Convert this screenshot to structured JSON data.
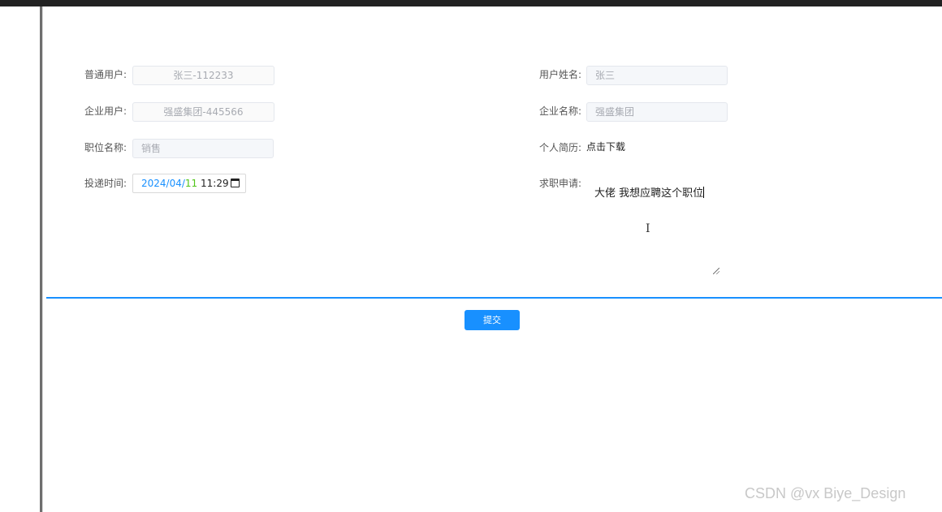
{
  "form": {
    "ordinary_user": {
      "label": "普通用户:",
      "value": "张三-112233"
    },
    "user_name": {
      "label": "用户姓名:",
      "value": "张三"
    },
    "enterprise_user": {
      "label": "企业用户:",
      "value": "强盛集团-445566"
    },
    "enterprise_name": {
      "label": "企业名称:",
      "value": "强盛集团"
    },
    "position_name": {
      "label": "职位名称:",
      "value": "销售"
    },
    "resume": {
      "label": "个人简历:",
      "link_text": "点击下载"
    },
    "delivery_time": {
      "label": "投递时间:",
      "year": "2024",
      "month": "04",
      "day": "11",
      "time": "11:29",
      "sep": "/"
    },
    "application": {
      "label": "求职申请:",
      "text": "大佬 我想应聘这个职位"
    },
    "submit_label": "提交"
  },
  "watermark": "CSDN @vx  Biye_Design",
  "colors": {
    "accent": "#1890ff",
    "day": "#52c41a",
    "topbar": "#222222"
  }
}
